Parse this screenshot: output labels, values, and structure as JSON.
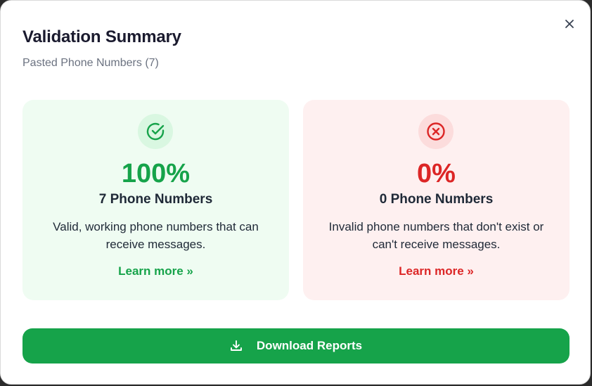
{
  "modal": {
    "title": "Validation Summary",
    "subtitle": "Pasted Phone Numbers (7)",
    "close_icon": "close-icon"
  },
  "valid_card": {
    "icon": "check-circle-icon",
    "percent": "100%",
    "count": "7 Phone Numbers",
    "description": "Valid, working phone numbers that can receive messages.",
    "link": "Learn more »",
    "color": "#16a34a"
  },
  "invalid_card": {
    "icon": "x-circle-icon",
    "percent": "0%",
    "count": "0 Phone Numbers",
    "description": "Invalid phone numbers that don't exist or can't receive messages.",
    "link": "Learn more »",
    "color": "#dc2626"
  },
  "download": {
    "icon": "download-icon",
    "label": "Download Reports",
    "color": "#16a34a"
  }
}
